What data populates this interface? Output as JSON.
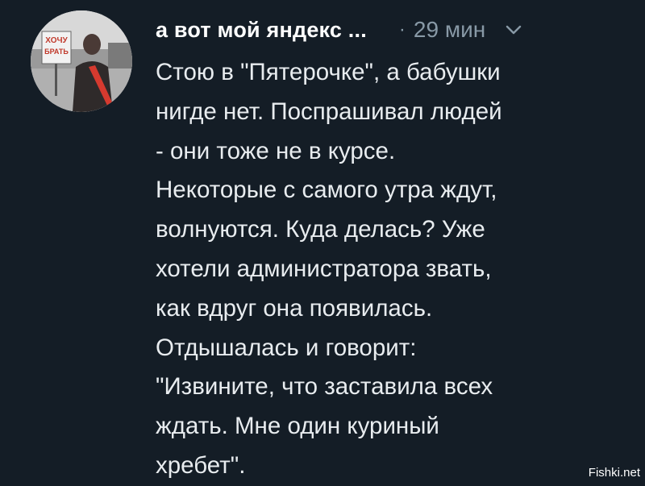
{
  "tweet": {
    "author_name": "а вот мой яндекс ...",
    "separator": "·",
    "time": "29 мин",
    "menu_icon": "chevron-down-icon",
    "avatar": {
      "sign_text_1": "ХОЧУ",
      "sign_text_2": "БРАТЬ"
    },
    "body_lines": [
      "Стою в \"Пятерочке\", а бабушки",
      "нигде нет. Поспрашивал людей",
      "- они тоже не в курсе.",
      "Некоторые с самого утра ждут,",
      "волнуются. Куда делась? Уже",
      "хотели администратора звать,",
      "как вдруг она появилась.",
      "Отдышалась и говорит:",
      "\"Извините, что заставила всех",
      "ждать. Мне один куриный",
      "хребет\"."
    ]
  },
  "watermark": "Fishki.net",
  "colors": {
    "background": "#141d26",
    "text": "#e8ecef",
    "muted": "#8899a6"
  }
}
